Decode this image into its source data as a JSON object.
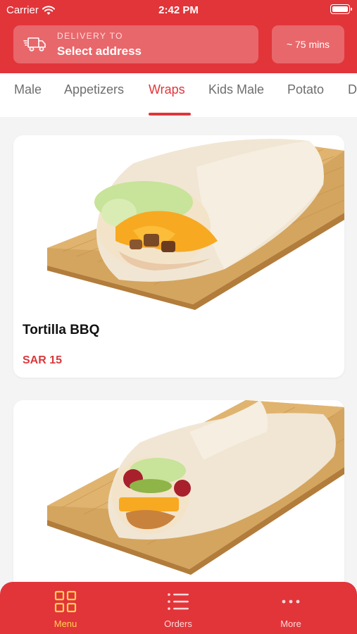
{
  "status": {
    "carrier": "Carrier",
    "time": "2:42 PM"
  },
  "header": {
    "delivery_label": "DELIVERY TO",
    "address": "Select address",
    "eta": "~ 75 mins"
  },
  "tabs": [
    {
      "label": "Male",
      "active": false
    },
    {
      "label": "Appetizers",
      "active": false
    },
    {
      "label": "Wraps",
      "active": true
    },
    {
      "label": "Kids Male",
      "active": false
    },
    {
      "label": "Potato",
      "active": false
    },
    {
      "label": "D",
      "active": false
    }
  ],
  "items": [
    {
      "name": "Tortilla BBQ",
      "price": "SAR 15"
    },
    {
      "name": "",
      "price": ""
    }
  ],
  "nav": [
    {
      "label": "Menu",
      "icon": "grid-icon",
      "active": true
    },
    {
      "label": "Orders",
      "icon": "list-icon",
      "active": false
    },
    {
      "label": "More",
      "icon": "more-dots-icon",
      "active": false
    }
  ],
  "colors": {
    "brand": "#e1353a",
    "active_nav": "#ffd34d",
    "price": "#d9393c"
  }
}
